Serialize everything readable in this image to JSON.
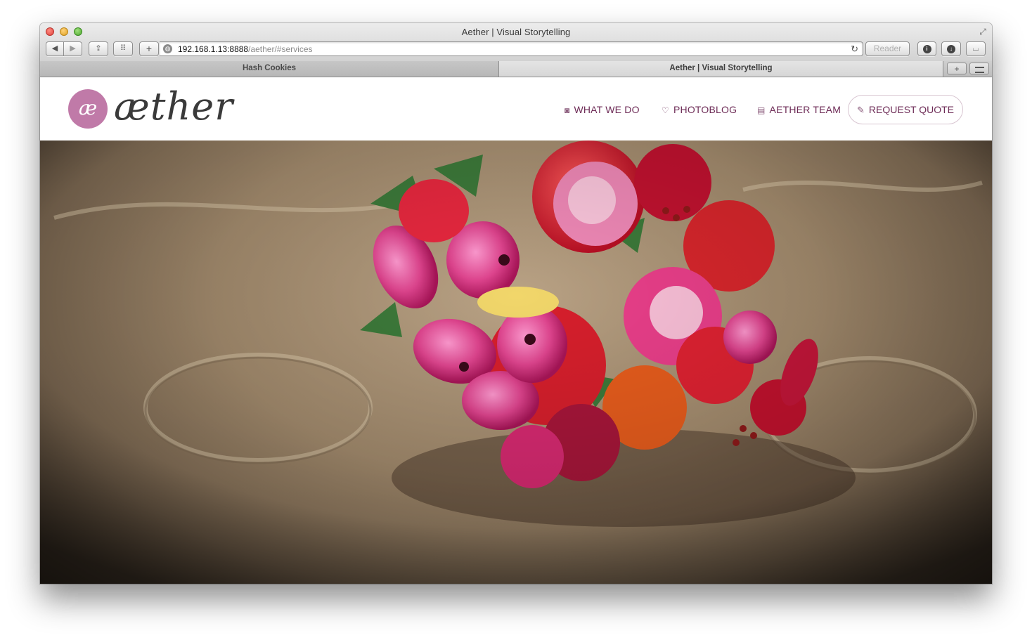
{
  "window": {
    "title": "Aether | Visual Storytelling"
  },
  "toolbar": {
    "back_icon": "◀",
    "forward_icon": "▶",
    "share_icon": "⇪",
    "grid_icon": "⠿",
    "add_icon": "+",
    "url_host": "192.168.1.13:8888",
    "url_path": "/aether/#services",
    "reload_icon": "↻",
    "reader_label": "Reader",
    "info_icon": "i",
    "download_icon": "↓",
    "sidebar_icon": "⌴"
  },
  "tabs": [
    {
      "label": "Hash Cookies",
      "active": false
    },
    {
      "label": "Aether | Visual Storytelling",
      "active": true
    }
  ],
  "new_tab_icon": "+",
  "site": {
    "logo_mark": "æ",
    "logo_text": "æther",
    "brand_color": "#c07aa8",
    "nav": [
      {
        "label": "WHAT WE DO",
        "icon": "camera-icon"
      },
      {
        "label": "PHOTOBLOG",
        "icon": "heart-icon"
      },
      {
        "label": "AETHER TEAM",
        "icon": "newspaper-icon"
      }
    ],
    "cta": {
      "label": "REQUEST QUOTE",
      "icon": "pencil-icon"
    },
    "nav_color": "#6e2c57"
  },
  "hero": {
    "image": "bouquet-on-sand-photo"
  }
}
